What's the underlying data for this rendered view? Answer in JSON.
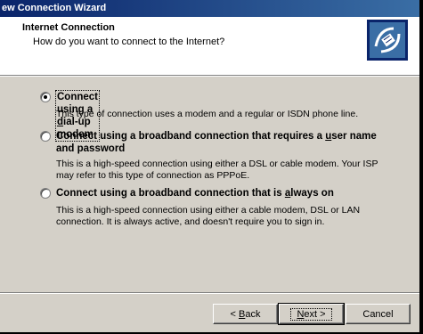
{
  "window": {
    "title": "ew Connection Wizard"
  },
  "header": {
    "title": "Internet Connection",
    "subtitle": "How do you want to connect to the Internet?",
    "icon": "network-connection-icon"
  },
  "options": [
    {
      "label_pre": "Connect using a ",
      "label_ul": "d",
      "label_post": "ial-up modem",
      "label_line2": "",
      "description": "This type of connection uses a modem and a regular or ISDN phone line.",
      "selected": true
    },
    {
      "label_pre": "Connect using a broadband connection that requires a ",
      "label_ul": "u",
      "label_post": "ser name",
      "label_line2": "and password",
      "description": "This is a high-speed connection using either a DSL or cable modem. Your ISP may refer to this type of connection as PPPoE.",
      "selected": false
    },
    {
      "label_pre": "Connect using a broadband connection that is ",
      "label_ul": "a",
      "label_post": "lways on",
      "label_line2": "",
      "description": "This is a high-speed connection using either a cable modem, DSL or LAN connection. It is always active, and doesn't require you to sign in.",
      "selected": false
    }
  ],
  "buttons": {
    "back_pre": "< ",
    "back_ul": "B",
    "back_post": "ack",
    "next_ul": "N",
    "next_post": "ext >",
    "cancel": "Cancel"
  }
}
